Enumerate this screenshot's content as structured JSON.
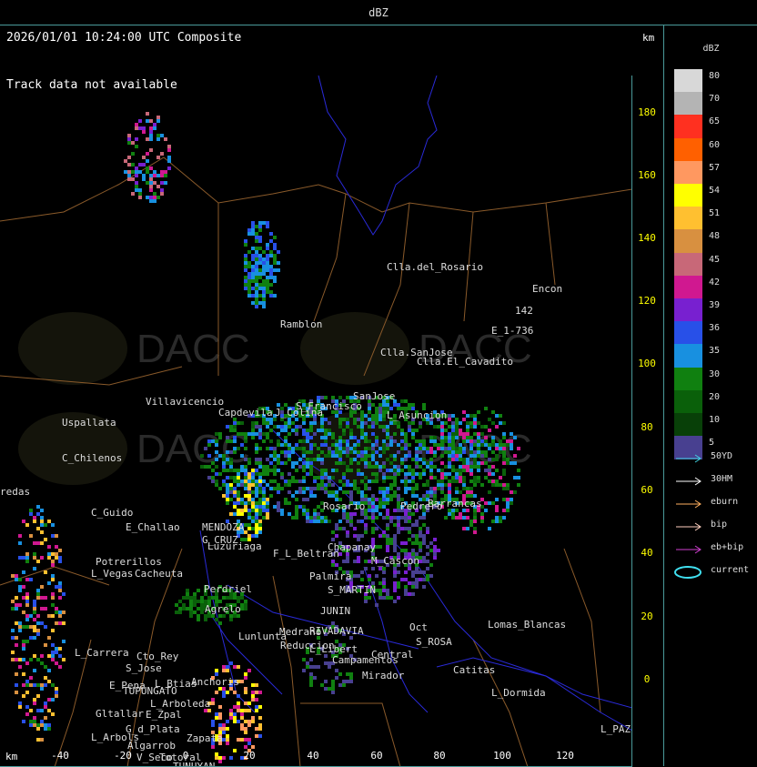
{
  "window_title": "dBZ",
  "header": {
    "timestamp": "2026/01/01 10:24:00 UTC Composite",
    "track_message": "Track data not available",
    "km_label": "km"
  },
  "axes": {
    "y_ticks": [
      "180",
      "160",
      "140",
      "120",
      "100",
      "80",
      "60",
      "40",
      "20",
      "0"
    ],
    "x_ticks": [
      "-40",
      "-20",
      "0",
      "20",
      "40",
      "60",
      "80",
      "100",
      "120"
    ],
    "x_unit": "km"
  },
  "watermark": "DACC",
  "places": [
    {
      "name": "Clla.del_Rosario"
    },
    {
      "name": "Encon"
    },
    {
      "name": "E_1-736"
    },
    {
      "name": "142"
    },
    {
      "name": "Ramblon"
    },
    {
      "name": "Clla.SanJose"
    },
    {
      "name": "Clla.El_Cavadito"
    },
    {
      "name": "Villavicencio"
    },
    {
      "name": "S_Francisco"
    },
    {
      "name": "SanJose"
    },
    {
      "name": "L_Asuncion"
    },
    {
      "name": "Uspallata"
    },
    {
      "name": "Capdevila"
    },
    {
      "name": "J_Colina"
    },
    {
      "name": "C_Chilenos"
    },
    {
      "name": "redas"
    },
    {
      "name": "C_Guido"
    },
    {
      "name": "E_Challao"
    },
    {
      "name": "MENDOZA"
    },
    {
      "name": "G_CRUZ"
    },
    {
      "name": "Luzuriaga"
    },
    {
      "name": "Potrerillos"
    },
    {
      "name": "L_Vegas"
    },
    {
      "name": "Cacheuta"
    },
    {
      "name": "F_L_Beltran"
    },
    {
      "name": "Chapanay"
    },
    {
      "name": "M_Cascon"
    },
    {
      "name": "Palmira"
    },
    {
      "name": "S_MARTIN"
    },
    {
      "name": "JUNIN"
    },
    {
      "name": "Perdriel"
    },
    {
      "name": "Agrelo"
    },
    {
      "name": "Lunlunta"
    },
    {
      "name": "Medrano"
    },
    {
      "name": "RIVADAVIA"
    },
    {
      "name": "Reduccion"
    },
    {
      "name": "L_Libert"
    },
    {
      "name": "Campamentos"
    },
    {
      "name": "S_ROSA"
    },
    {
      "name": "Lomas_Blancas"
    },
    {
      "name": "L_Carrera"
    },
    {
      "name": "Cto_Rey"
    },
    {
      "name": "S_Jose"
    },
    {
      "name": "E_Pena"
    },
    {
      "name": "TUPUNGATO"
    },
    {
      "name": "L_Btias"
    },
    {
      "name": "Anchoris"
    },
    {
      "name": "L_Arboleda"
    },
    {
      "name": "Gltallar"
    },
    {
      "name": "E_Zpal"
    },
    {
      "name": "G_d_Plata"
    },
    {
      "name": "L_Arbols"
    },
    {
      "name": "Zapata"
    },
    {
      "name": "Algarrob"
    },
    {
      "name": "V_Seco"
    },
    {
      "name": "Totoral"
    },
    {
      "name": "Ma"
    },
    {
      "name": "C_L_Rosas"
    },
    {
      "name": "TUNUYAN"
    },
    {
      "name": "V_Flores"
    },
    {
      "name": "Catitas"
    },
    {
      "name": "L_Dormida"
    },
    {
      "name": "Mirador"
    },
    {
      "name": "Central"
    },
    {
      "name": "L_PAZ"
    },
    {
      "name": "Oct"
    },
    {
      "name": "Pedrero"
    },
    {
      "name": "Barrancas"
    },
    {
      "name": "Rosario"
    }
  ],
  "legend": {
    "title": "dBZ",
    "scale": [
      {
        "label": "80",
        "color": "#d8d8d8"
      },
      {
        "label": "70",
        "color": "#b4b4b4"
      },
      {
        "label": "65",
        "color": "#ff3020"
      },
      {
        "label": "60",
        "color": "#ff6000"
      },
      {
        "label": "57",
        "color": "#ff9860"
      },
      {
        "label": "54",
        "color": "#ffff00"
      },
      {
        "label": "51",
        "color": "#ffc030"
      },
      {
        "label": "48",
        "color": "#d89040"
      },
      {
        "label": "45",
        "color": "#c86878"
      },
      {
        "label": "42",
        "color": "#d01890"
      },
      {
        "label": "39",
        "color": "#7820d0"
      },
      {
        "label": "36",
        "color": "#2850e8"
      },
      {
        "label": "35",
        "color": "#1890e0"
      },
      {
        "label": "30",
        "color": "#108010"
      },
      {
        "label": "20",
        "color": "#0a600a"
      },
      {
        "label": "10",
        "color": "#084008"
      },
      {
        "label": "5",
        "color": "#484090"
      }
    ],
    "tracks": [
      {
        "label": "50YD",
        "color": "#40d0e0"
      },
      {
        "label": "30HM",
        "color": "#ffffff"
      },
      {
        "label": "eburn",
        "color": "#ffb060"
      },
      {
        "label": "bip",
        "color": "#ffd0c0"
      },
      {
        "label": "eb+bip",
        "color": "#d040d0"
      },
      {
        "label": "current",
        "color": "#40e0f0"
      }
    ]
  }
}
